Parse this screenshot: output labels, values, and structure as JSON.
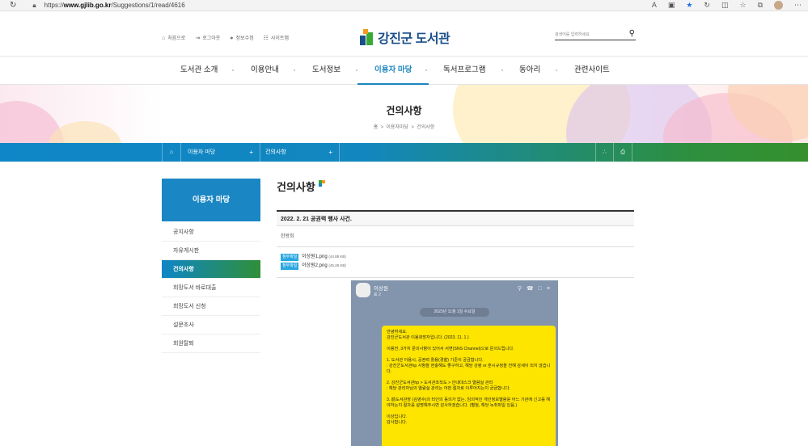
{
  "browser": {
    "url_prefix": "https://",
    "url_host": "www.gjlib.go.kr",
    "url_path": "/Suggestions/1/read/4616"
  },
  "util_links": [
    "처음으로",
    "로그아웃",
    "정보수정",
    "사이트맵"
  ],
  "logo_text": "강진군 도서관",
  "search_placeholder": "검색어를 입력하세요",
  "gnb": [
    "도서관 소개",
    "이용안내",
    "도서정보",
    "이용자 마당",
    "독서프로그램",
    "동아리",
    "관련사이트"
  ],
  "visual": {
    "title": "건의사항",
    "crumb_home": "홈",
    "crumb_1": "이용자마당",
    "crumb_2": "건의사항"
  },
  "subnav": {
    "depth1": "이용자 마당",
    "depth2": "건의사항"
  },
  "lnb": {
    "head": "이용자 마당",
    "items": [
      "공지사항",
      "자유게시판",
      "건의사항",
      "희망도서 바로대출",
      "희망도서 신청",
      "설문조사",
      "회원탈퇴"
    ]
  },
  "content": {
    "heading": "건의사항",
    "post_title": "2022. 2. 21 공권력 행사 사건.",
    "writer": "한왕희",
    "attach_label": "첨부파일",
    "files": [
      {
        "name": "이상원1.png",
        "size": "(44.88 KB)"
      },
      {
        "name": "이상원2.png",
        "size": "(45.28 KB)"
      }
    ]
  },
  "chat": {
    "name": "이상원",
    "sub": "표 2",
    "date": "2023년 11월 1일 수요일",
    "message": "안녕하세요.\n강진군도서관 이용희망자입니다. (2023. 11. 1.)\n\n이용전, 3가지 문의사항이 있어서 서면(SNS Channel)으로 문의드립니다.\n\n1. 도서관 이용시, 공권력 활용(경찰) 기준이 궁금합니다.\n : 강진군도서관hp 사항을 현충해도 좋구하고, 해당 강령 or 훈시규정을 전해 감새이 되지 않습니다.\n\n2. 강진군도서관hp > 도서관조직도 > 안내데스크 열람실 관리\n : 해당 관리자님의 열람실 관리는 어떤 절차로 이루어지는지 궁금합니다.\n\n3. 前도서관장 (김영수)의 타인의 동의가 없는, 임의적인 개인정보열람윤 어느 기관에 신고를 해야하는지 절차를 설명해주시면 감사하겠습니다. (별첨, 해당 녹취파일 있음.)\n\n이상입니다.\n감사합니다."
  },
  "colors": {
    "primary": "#1a86c3",
    "green": "#35902c",
    "chat_bg": "#8395ad",
    "bubble": "#fee500"
  }
}
